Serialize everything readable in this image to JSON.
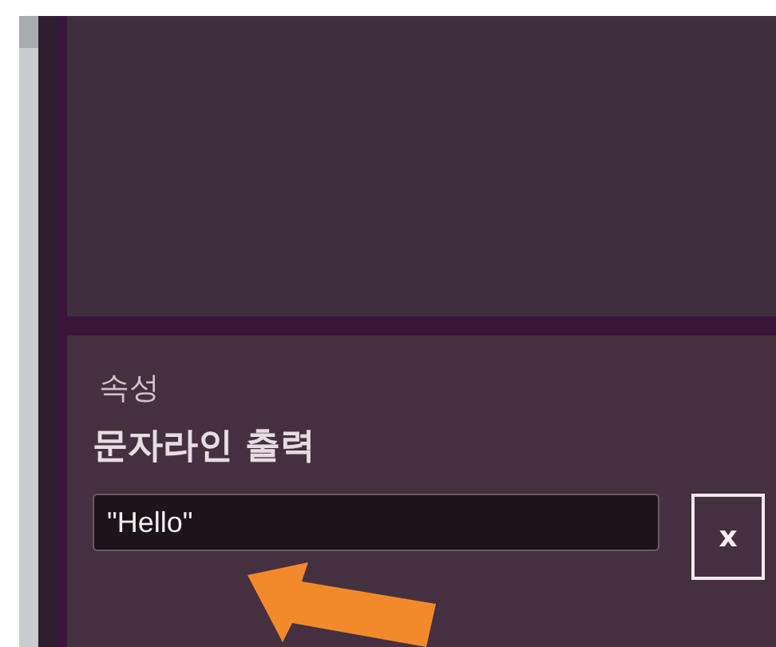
{
  "properties_panel": {
    "section_label": "속성",
    "title": "문자라인 출력",
    "field": {
      "value": "\"Hello\""
    },
    "clear_button": "x"
  }
}
